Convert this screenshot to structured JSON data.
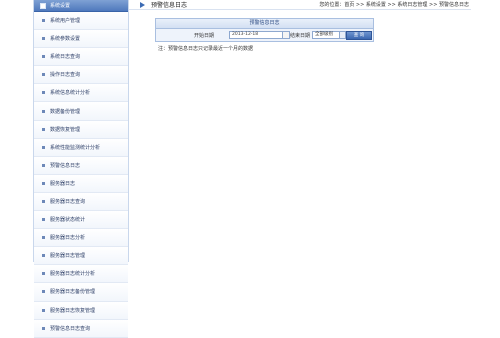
{
  "sidebar": {
    "header": "系统设置",
    "items": [
      {
        "label": "系统用户管理"
      },
      {
        "label": "系统参数设置"
      },
      {
        "label": "系统日志查询"
      },
      {
        "label": "操作日志查询"
      },
      {
        "label": "系统信息统计分析"
      },
      {
        "label": "数据备份管理"
      },
      {
        "label": "数据恢复管理"
      },
      {
        "label": "系统性能监测统计分析"
      },
      {
        "label": "预警信息日志"
      },
      {
        "label": "服务器日志"
      },
      {
        "label": "服务器日志查询"
      },
      {
        "label": "服务器状态统计"
      },
      {
        "label": "服务器日志分析"
      },
      {
        "label": "服务器日志管理"
      },
      {
        "label": "服务器日志统计分析"
      },
      {
        "label": "服务器日志备份管理"
      },
      {
        "label": "服务器日志恢复管理"
      },
      {
        "label": "预警信息日志查询"
      }
    ]
  },
  "topbar": {
    "title": "预警信息日志",
    "breadcrumb": "您的位置：首页 >> 系统设置 >> 系统日志管理 >> 预警信息日志"
  },
  "panel": {
    "title": "预警信息日志",
    "start_label": "开始日期",
    "start_value": "2013-12-18",
    "end_label": "结束日期",
    "select_value": "全部级别",
    "search_label": "查 询"
  },
  "note": "注：预警信息日志只记录最近一个月的数据"
}
